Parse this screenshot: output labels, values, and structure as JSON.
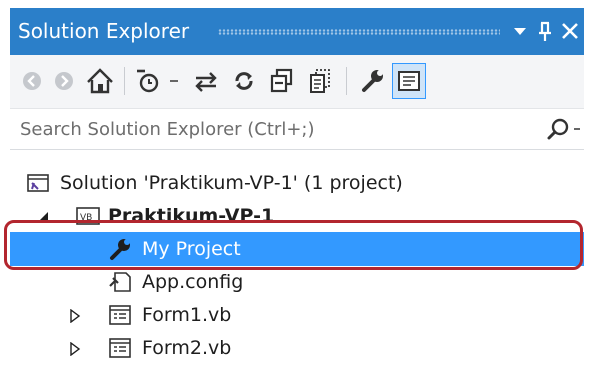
{
  "window": {
    "title": "Solution Explorer",
    "dropdown_icon": "dropdown-arrow-icon",
    "pin_icon": "pin-icon",
    "close_icon": "close-icon"
  },
  "toolbar": {
    "items": [
      "back-icon",
      "forward-icon",
      "home-icon",
      "pending-changes-icon",
      "dropdown-arrow-icon",
      "sync-icon",
      "refresh-icon",
      "collapse-all-icon",
      "show-all-files-icon",
      "properties-icon",
      "preview-selected-items-icon"
    ]
  },
  "search": {
    "placeholder": "Search Solution Explorer (Ctrl+;)"
  },
  "tree": {
    "solution": "Solution 'Praktikum-VP-1' (1 project)",
    "project": "Praktikum-VP-1",
    "items": [
      {
        "label": "My Project",
        "icon": "wrench-icon",
        "selected": true
      },
      {
        "label": "App.config",
        "icon": "config-file-icon"
      },
      {
        "label": "Form1.vb",
        "icon": "form-icon"
      },
      {
        "label": "Form2.vb",
        "icon": "form-icon"
      }
    ]
  },
  "colors": {
    "titlebar": "#2b7fc9",
    "selection": "#3399ff",
    "highlight_border": "#b3262e"
  }
}
